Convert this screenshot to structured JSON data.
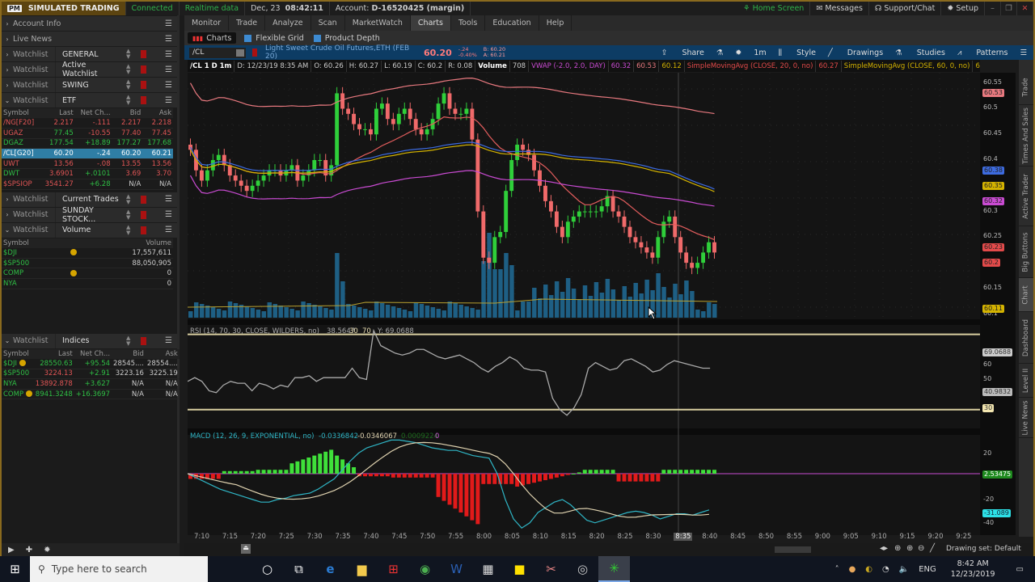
{
  "titlebar": {
    "logo": "PM",
    "mode": "SIMULATED TRADING",
    "connection": "Connected",
    "data_status": "Realtime data",
    "date": "Dec, 23",
    "time": "08:42:11",
    "account_label": "Account:",
    "account": "D-16520425 (margin)",
    "right_items": [
      "Home Screen",
      "Messages",
      "Support/Chat",
      "Setup"
    ]
  },
  "sidebar": {
    "sections": [
      {
        "title": "Account Info"
      },
      {
        "title": "Live News"
      }
    ],
    "watchlists": [
      {
        "label": "Watchlist",
        "name": "GENERAL",
        "expanded": false
      },
      {
        "label": "Watchlist",
        "name": "Active Watchlist",
        "expanded": false
      },
      {
        "label": "Watchlist",
        "name": "SWING",
        "expanded": false
      },
      {
        "label": "Watchlist",
        "name": "ETF",
        "expanded": true
      },
      {
        "label": "Watchlist",
        "name": "Current Trades",
        "expanded": false
      },
      {
        "label": "Watchlist",
        "name": "SUNDAY STOCK...",
        "expanded": false
      },
      {
        "label": "Watchlist",
        "name": "Volume",
        "expanded": true
      },
      {
        "label": "Watchlist",
        "name": "Indices",
        "expanded": true
      }
    ],
    "etf_table": {
      "headers": [
        "Symbol",
        "Last",
        "Net Ch...",
        "Bid",
        "Ask"
      ],
      "rows": [
        {
          "symbol": "/NG[F20]",
          "last": "2.217",
          "net": "-.111",
          "bid": "2.217",
          "ask": "2.218",
          "sym_color": "r",
          "last_color": "r",
          "net_color": "r",
          "bid_color": "r",
          "ask_color": "r"
        },
        {
          "symbol": "UGAZ",
          "last": "77.45",
          "net": "-10.55",
          "bid": "77.40",
          "ask": "77.45",
          "sym_color": "r",
          "last_color": "g",
          "net_color": "r",
          "bid_color": "r",
          "ask_color": "r"
        },
        {
          "symbol": "DGAZ",
          "last": "177.54",
          "net": "+18.89",
          "bid": "177.27",
          "ask": "177.68",
          "sym_color": "g",
          "last_color": "g",
          "net_color": "g",
          "bid_color": "g",
          "ask_color": "g"
        },
        {
          "symbol": "/CL[G20]",
          "last": "60.20",
          "net": "-.24",
          "bid": "60.20",
          "ask": "60.21",
          "selected": true
        },
        {
          "symbol": "UWT",
          "last": "13.56",
          "net": "-.08",
          "bid": "13.55",
          "ask": "13.56",
          "sym_color": "r",
          "last_color": "r",
          "net_color": "r",
          "bid_color": "r",
          "ask_color": "r"
        },
        {
          "symbol": "DWT",
          "last": "3.6901",
          "net": "+.0101",
          "bid": "3.69",
          "ask": "3.70",
          "sym_color": "g",
          "last_color": "r",
          "net_color": "g",
          "bid_color": "r",
          "ask_color": "r"
        },
        {
          "symbol": "$SPSIOP",
          "last": "3541.27",
          "net": "+6.28",
          "bid": "N/A",
          "ask": "N/A",
          "sym_color": "r",
          "last_color": "r",
          "net_color": "g",
          "bid_color": "w",
          "ask_color": "w"
        }
      ]
    },
    "volume_table": {
      "headers": [
        "Symbol",
        "Volume"
      ],
      "rows": [
        {
          "symbol": "$DJI",
          "volume": "17,557,611",
          "bullet": true
        },
        {
          "symbol": "$SP500",
          "volume": "88,050,905",
          "bullet": false
        },
        {
          "symbol": "COMP",
          "volume": "0",
          "bullet": true
        },
        {
          "symbol": "NYA",
          "volume": "0",
          "bullet": false
        }
      ]
    },
    "indices_table": {
      "headers": [
        "Symbol",
        "Last",
        "Net Ch...",
        "Bid",
        "Ask"
      ],
      "rows": [
        {
          "symbol": "$DJI",
          "last": "28550.63",
          "net": "+95.54",
          "bid": "28545....",
          "ask": "28554....",
          "bullet": true,
          "last_color": "g"
        },
        {
          "symbol": "$SP500",
          "last": "3224.13",
          "net": "+2.91",
          "bid": "3223.16",
          "ask": "3225.19",
          "bullet": false,
          "last_color": "r"
        },
        {
          "symbol": "NYA",
          "last": "13892.878",
          "net": "+3.627",
          "bid": "N/A",
          "ask": "N/A",
          "bullet": false,
          "last_color": "r"
        },
        {
          "symbol": "COMP",
          "last": "8941.3248",
          "net": "+16.3697",
          "bid": "N/A",
          "ask": "N/A",
          "bullet": true,
          "last_color": "g"
        }
      ]
    }
  },
  "topnav": {
    "items": [
      "Monitor",
      "Trade",
      "Analyze",
      "Scan",
      "MarketWatch",
      "Charts",
      "Tools",
      "Education",
      "Help"
    ],
    "active": "Charts"
  },
  "subnav": {
    "items": [
      "Charts",
      "Flexible Grid",
      "Product Depth"
    ],
    "active": "Charts"
  },
  "chart_header": {
    "symbol": "/CL",
    "description": "Light Sweet Crude Oil Futures,ETH (FEB 20)",
    "price": "60.20",
    "change": "-.24",
    "change_pct": "-0.40%",
    "bid": "B: 60.20",
    "ask": "A: 60.21",
    "tools": [
      "Share",
      "1m",
      "Style",
      "Drawings",
      "Studies",
      "Patterns"
    ]
  },
  "study_row": {
    "label": "/CL 1 D 1m",
    "date": "D: 12/23/19 8:35 AM",
    "open": "O: 60.26",
    "high": "H: 60.27",
    "low": "L: 60.19",
    "close": "C: 60.2",
    "range": "R: 0.08",
    "volume_label": "Volume",
    "volume": "708",
    "vwap_label": "VWAP (-2.0, 2.0, DAY)",
    "vwap_vals": [
      "60.32",
      "60.53",
      "60.12"
    ],
    "sma20_label": "SimpleMovingAvg (CLOSE, 20, 0, no)",
    "sma20": "60.27",
    "sma60_label": "SimpleMovingAvg (CLOSE, 60, 0, no)",
    "sma60": "60.38",
    "more": "..."
  },
  "rsi_row": {
    "label": "RSI (14, 70, 30, CLOSE, WILDERS, no)",
    "value": "38.5647",
    "low": "30",
    "high": "70",
    "y": "Y: 69.0688"
  },
  "macd_row": {
    "label": "MACD (12, 26, 9, EXPONENTIAL, no)",
    "value": "-0.0336842",
    "avg": "-0.0346067",
    "diff": "0.0009224",
    "zero": "0"
  },
  "price_axis": {
    "ticks": [
      "60.55",
      "60.5",
      "60.45",
      "60.4",
      "60.3",
      "60.25",
      "60.15",
      "60.1"
    ],
    "tags": [
      {
        "label": "60.53",
        "color": "#e8797f"
      },
      {
        "label": "60.38",
        "color": "#3d6be0"
      },
      {
        "label": "60.35",
        "color": "#d4b300"
      },
      {
        "label": "60.32",
        "color": "#c94bd2"
      },
      {
        "label": "60.23",
        "color": "#e24a4a"
      },
      {
        "label": "60.2",
        "color": "#e24a4a"
      },
      {
        "label": "60.11",
        "color": "#d4b300"
      }
    ]
  },
  "rsi_axis": {
    "ticks": [
      "60",
      "50",
      "40"
    ],
    "tags": [
      "69.0688",
      "40.9832",
      "30"
    ]
  },
  "macd_axis": {
    "ticks": [
      "20",
      "0",
      "-20",
      "-40"
    ],
    "tags": [
      "2.53475",
      "-31.089"
    ],
    "unit": "<thousandths>"
  },
  "time_axis": {
    "ticks": [
      "7:10",
      "7:15",
      "7:20",
      "7:25",
      "7:30",
      "7:35",
      "7:40",
      "7:45",
      "7:50",
      "7:55",
      "8:00",
      "8:05",
      "8:10",
      "8:15",
      "8:20",
      "8:25",
      "8:30",
      "8:35",
      "8:40",
      "8:45",
      "8:50",
      "8:55",
      "9:00",
      "9:05",
      "9:10",
      "9:15",
      "9:20",
      "9:25"
    ],
    "cursor": "8:35"
  },
  "right_tabs": [
    "Trade",
    "Times And Sales",
    "Active Trader",
    "Big Buttons",
    "Chart",
    "Dashboard",
    "Level II",
    "Live News"
  ],
  "right_tab_active": "Chart",
  "bottom_bar": {
    "drawing_set": "Drawing set: Default"
  },
  "taskbar": {
    "search_placeholder": "Type here to search",
    "time": "8:42 AM",
    "date": "12/23/2019",
    "lang": "ENG"
  },
  "chart_data": {
    "type": "candlestick",
    "symbol": "/CL",
    "interval": "1m",
    "ylim": [
      60.09,
      60.57
    ],
    "candles_close": [
      60.42,
      60.38,
      60.36,
      60.38,
      60.4,
      60.41,
      60.39,
      60.37,
      60.36,
      60.35,
      60.34,
      60.35,
      60.36,
      60.37,
      60.38,
      60.38,
      60.37,
      60.38,
      60.39,
      60.36,
      60.37,
      60.38,
      60.4,
      60.4,
      60.37,
      60.39,
      60.53,
      60.5,
      60.49,
      60.47,
      60.46,
      60.46,
      60.45,
      60.5,
      60.51,
      60.48,
      60.47,
      60.49,
      60.5,
      60.48,
      60.46,
      60.45,
      60.46,
      60.48,
      60.51,
      60.53,
      60.5,
      60.49,
      60.49,
      60.5,
      60.44,
      60.3,
      60.21,
      60.2,
      60.25,
      60.26,
      60.34,
      60.4,
      60.43,
      60.42,
      60.41,
      60.38,
      60.35,
      60.32,
      60.3,
      60.27,
      60.25,
      60.28,
      60.29,
      60.3,
      60.3,
      60.3,
      60.3,
      60.31,
      60.33,
      60.3,
      60.29,
      60.27,
      60.25,
      60.24,
      60.23,
      60.22,
      60.21,
      60.25,
      60.28,
      60.29,
      60.25,
      60.22,
      60.2,
      60.19,
      60.2,
      60.22,
      60.24,
      60.22
    ],
    "rsi_ylim": [
      20,
      75
    ],
    "rsi_levels": [
      30,
      70
    ],
    "macd_ylim": [
      -45,
      30
    ]
  }
}
